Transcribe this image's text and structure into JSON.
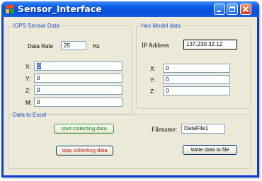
{
  "window": {
    "title": "Sensor_Interface"
  },
  "igps": {
    "legend": "IGPS Sensor Data",
    "data_rate_label": "Data Rate",
    "data_rate_value": "25",
    "data_rate_unit": "Hz",
    "x_label": "X:",
    "x_value": "0",
    "y_label": "Y:",
    "y_value": "0",
    "z_label": "Z:",
    "z_value": "0",
    "m_label": "M:",
    "m_value": "0"
  },
  "hex": {
    "legend": "Hex Model data",
    "ip_label": "IP Address",
    "ip_value": "137.230.32.12",
    "x_label": "X:",
    "x_value": "0",
    "y_label": "Y:",
    "y_value": "0",
    "z_label": "Z:",
    "z_value": "0"
  },
  "excel": {
    "legend": "Data to Excel",
    "start_label": "start collecting data",
    "stop_label": "stop collecting data",
    "filename_label": "Filename:",
    "filename_value": "DataFile1",
    "write_label": "Write data to file"
  }
}
